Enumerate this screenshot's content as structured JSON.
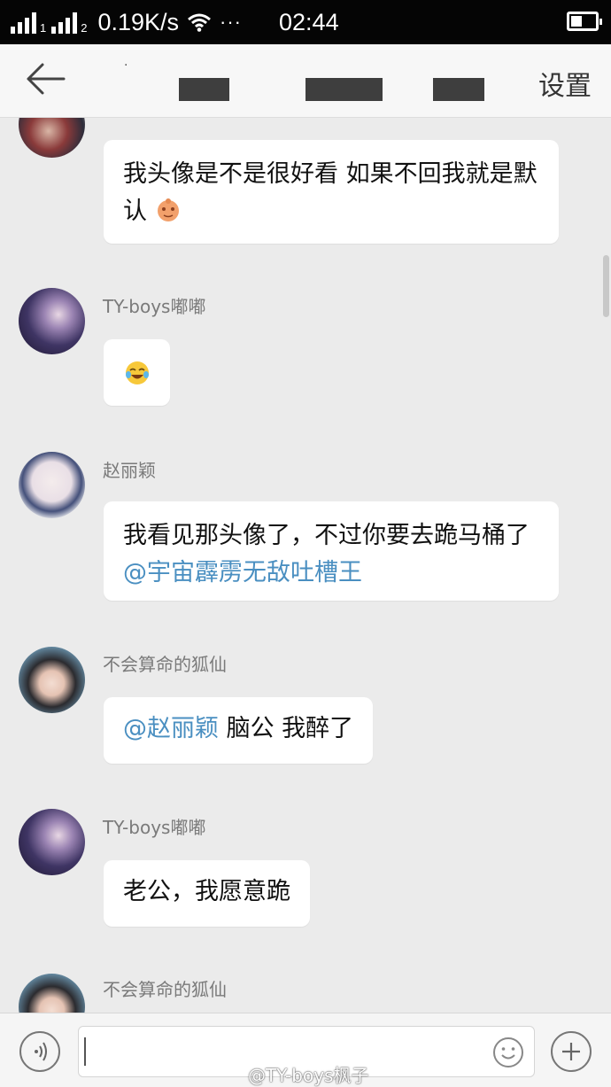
{
  "status_bar": {
    "sim1": "1",
    "sim2": "2",
    "net_speed": "0.19K/s",
    "dots": "···",
    "time": "02:44"
  },
  "header": {
    "settings_label": "设置"
  },
  "messages": [
    {
      "sender": "",
      "text": "我头像是不是很好看 如果不回我就是默认"
    },
    {
      "sender": "TY-boys嘟嘟",
      "emoji": "😂"
    },
    {
      "sender": "赵丽颖",
      "text": "我看见那头像了，不过你要去跪马桶了",
      "mention": "@宇宙霹雳无敌吐槽王"
    },
    {
      "sender": "不会算命的狐仙",
      "mention": "@赵丽颖",
      "text": " 脑公 我醉了"
    },
    {
      "sender": "TY-boys嘟嘟",
      "text": "老公，我愿意跪"
    },
    {
      "sender": "不会算命的狐仙"
    }
  ],
  "watermark": "@TY-boys枫子",
  "colors": {
    "mention": "#4a8fc1",
    "background": "#ebebeb"
  }
}
